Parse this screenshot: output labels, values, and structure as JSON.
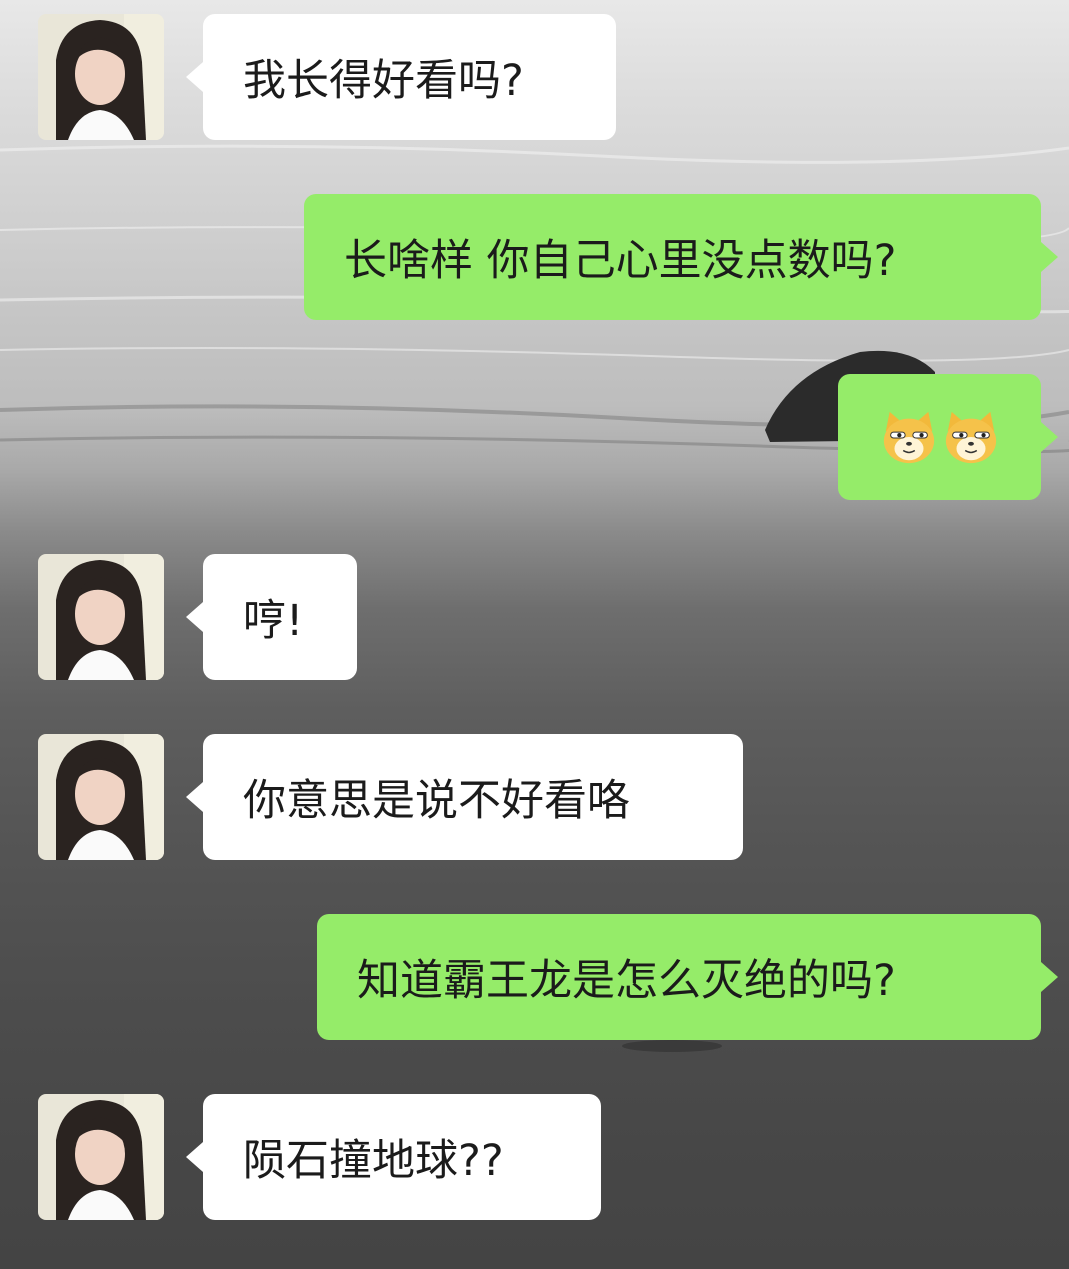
{
  "chat": {
    "messages": [
      {
        "side": "left",
        "text": "我长得好看吗?"
      },
      {
        "side": "right",
        "text": "长啥样 你自己心里没点数吗?"
      },
      {
        "side": "right",
        "emoji": [
          "doge-icon",
          "doge-icon"
        ]
      },
      {
        "side": "left",
        "text": "哼!"
      },
      {
        "side": "left",
        "text": "你意思是说不好看咯"
      },
      {
        "side": "right",
        "text": "知道霸王龙是怎么灭绝的吗?"
      },
      {
        "side": "left",
        "text": "陨石撞地球??"
      }
    ]
  },
  "colors": {
    "self_bubble": "#95ec69",
    "other_bubble": "#ffffff"
  }
}
